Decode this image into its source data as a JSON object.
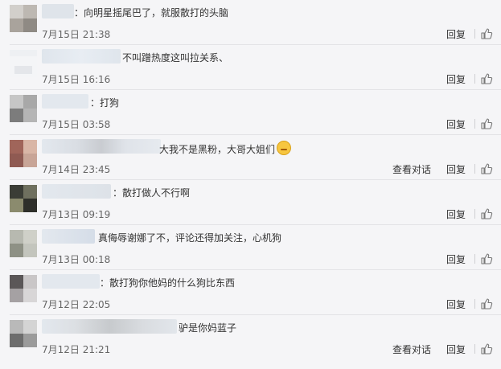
{
  "labels": {
    "reply": "回复",
    "view_dialog": "查看对话"
  },
  "comments": [
    {
      "text": "：向明星摇尾巴了，就服散打的头脑",
      "time": "7月15日 21:38",
      "has_view_dialog": false
    },
    {
      "text": "不叫蹭热度这叫拉关系、",
      "time": "7月15日 16:16",
      "has_view_dialog": false
    },
    {
      "text": "：打狗",
      "time": "7月15日 03:58",
      "has_view_dialog": false
    },
    {
      "text": "大我不是黑粉，大哥大姐们",
      "time": "7月14日 23:45",
      "has_view_dialog": true
    },
    {
      "text": "：散打做人不行啊",
      "time": "7月13日 09:19",
      "has_view_dialog": false
    },
    {
      "text": "真侮辱谢娜了不，评论还得加关注，心机狗",
      "time": "7月13日 00:18",
      "has_view_dialog": false
    },
    {
      "text": "：散打狗你他妈的什么狗比东西",
      "time": "7月12日 22:05",
      "has_view_dialog": false
    },
    {
      "text": "驴是你妈蓝子",
      "time": "7月12日 21:21",
      "has_view_dialog": true
    }
  ],
  "colors": {
    "background": "#f5f5f7",
    "separator": "#e3e3e6",
    "text": "#333333",
    "timestamp": "#666666"
  },
  "icons": {
    "like": "thumbs-up-icon",
    "emoji": "embarrassed-face-emoji-icon"
  }
}
